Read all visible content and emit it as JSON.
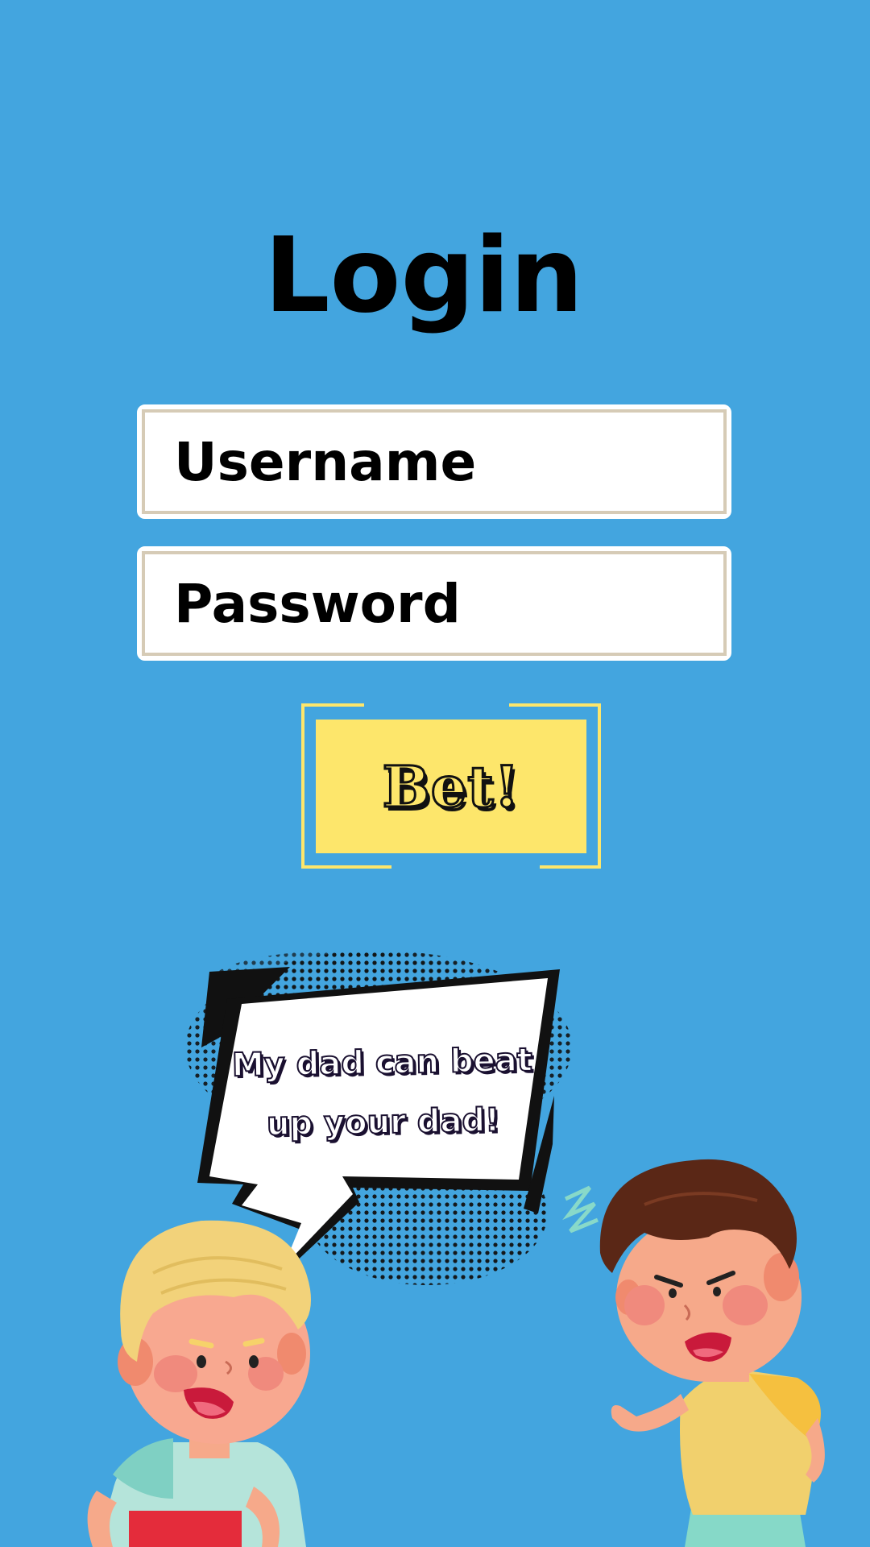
{
  "login": {
    "title": "Login",
    "username_placeholder": "Username",
    "password_placeholder": "Password",
    "submit_label": "Bet!"
  },
  "illustration": {
    "speech_bubble": "My dad can beat up your dad!"
  },
  "colors": {
    "background": "#43a5df",
    "button": "#fde66b",
    "field_border": "#d6cbb6"
  }
}
